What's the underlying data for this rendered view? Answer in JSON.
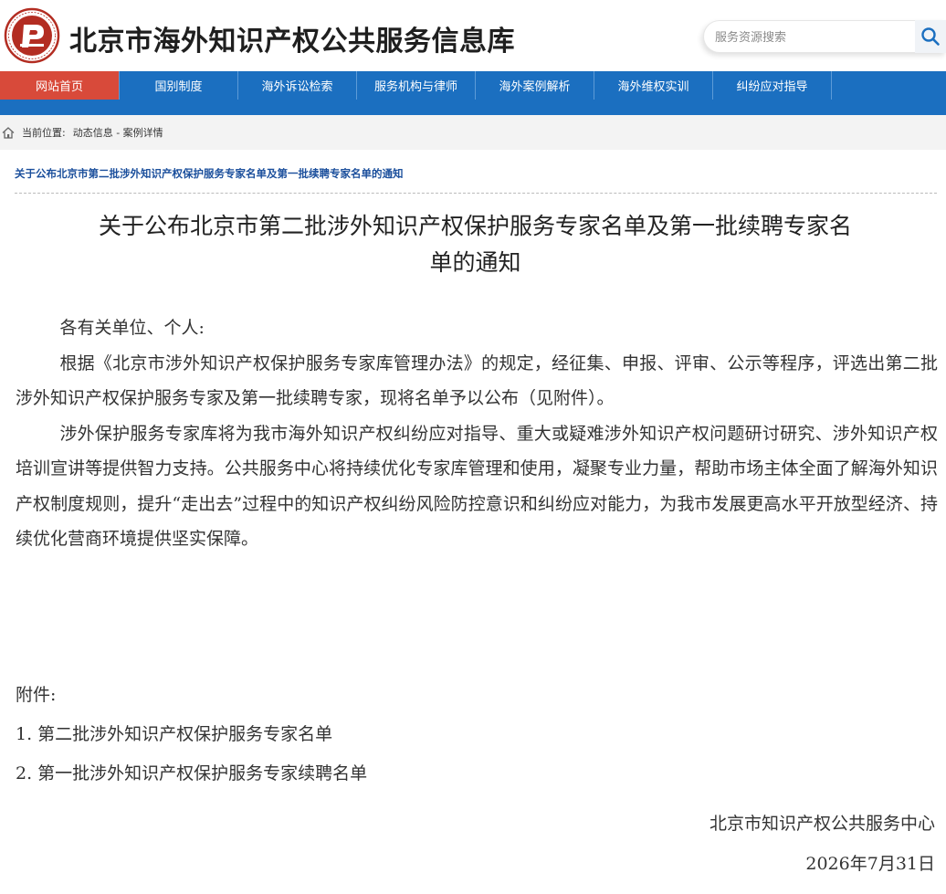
{
  "header": {
    "site_title": "北京市海外知识产权公共服务信息库",
    "search_placeholder": "服务资源搜索"
  },
  "nav": {
    "items": [
      {
        "label": "网站首页",
        "active": true
      },
      {
        "label": "国别制度"
      },
      {
        "label": "海外诉讼检索"
      },
      {
        "label": "服务机构与律师"
      },
      {
        "label": "海外案例解析"
      },
      {
        "label": "海外维权实训"
      },
      {
        "label": "纠纷应对指导"
      }
    ]
  },
  "breadcrumb": {
    "label": "当前位置:",
    "path": "动态信息 - 案例详情"
  },
  "article": {
    "sub_title": "关于公布北京市第二批涉外知识产权保护服务专家名单及第一批续聘专家名单的通知",
    "title_line1": "关于公布北京市第二批涉外知识产权保护服务专家名单及第一批续聘专家名",
    "title_line2": "单的通知",
    "salutation": "各有关单位、个人:",
    "paragraph1": "根据《北京市涉外知识产权保护服务专家库管理办法》的规定，经征集、申报、评审、公示等程序，评选出第二批涉外知识产权保护服务专家及第一批续聘专家，现将名单予以公布（见附件）。",
    "paragraph2": "涉外保护服务专家库将为我市海外知识产权纠纷应对指导、重大或疑难涉外知识产权问题研讨研究、涉外知识产权培训宣讲等提供智力支持。公共服务中心将持续优化专家库管理和使用，凝聚专业力量，帮助市场主体全面了解海外知识产权制度规则，提升“走出去”过程中的知识产权纠纷风险防控意识和纠纷应对能力，为我市发展更高水平开放型经济、持续优化营商环境提供坚实保障。",
    "attachments_label": "附件:",
    "attachments": [
      "1. 第二批涉外知识产权保护服务专家名单",
      "2. 第一批涉外知识产权保护服务专家续聘名单"
    ],
    "signature": "北京市知识产权公共服务中心",
    "date": "2026年7月31日"
  },
  "colors": {
    "nav_blue": "#1b6fc0",
    "nav_active": "#d84a3a",
    "subtitle_blue": "#1b4f9c"
  },
  "icons": [
    "logo-emblem",
    "search-icon",
    "home-icon"
  ]
}
